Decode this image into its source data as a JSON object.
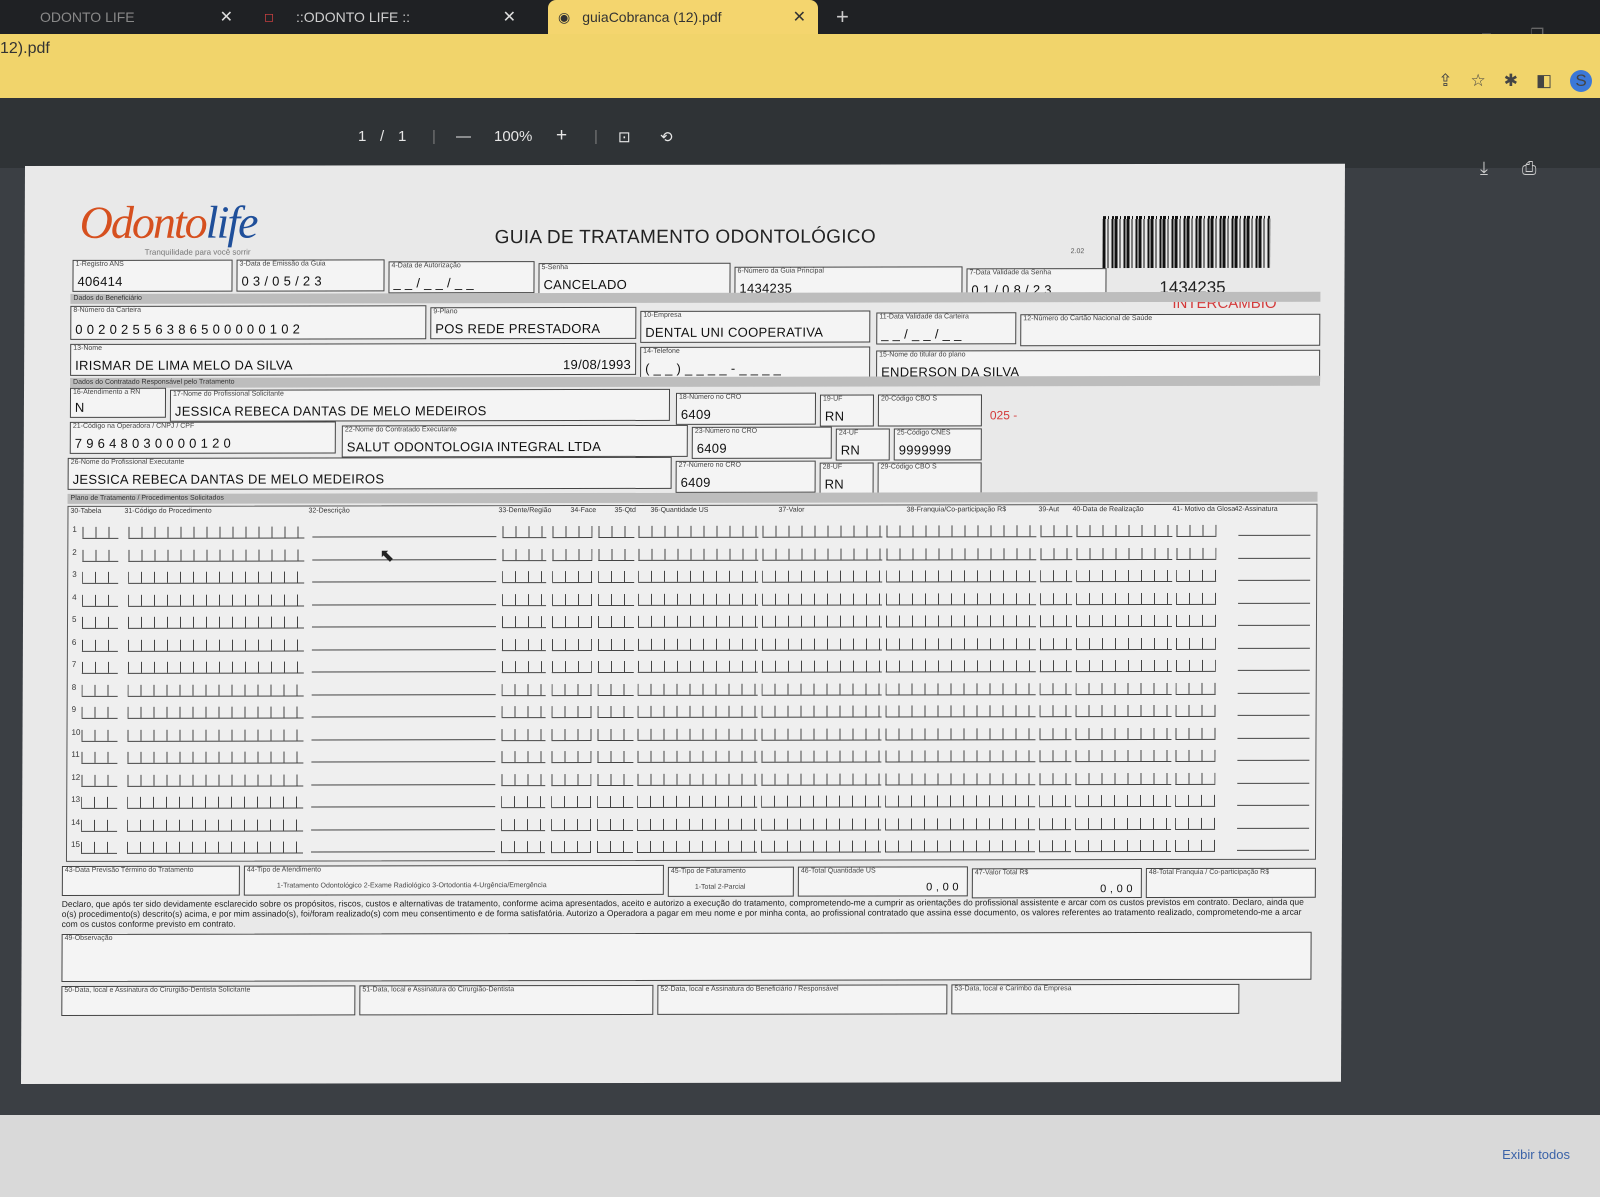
{
  "browser": {
    "tabs": [
      {
        "label": "ODONTO LIFE"
      },
      {
        "label": "::ODONTO LIFE ::"
      },
      {
        "label": "guiaCobranca (12).pdf"
      }
    ],
    "new_tab": "+",
    "url": "12).pdf",
    "close_glyph": "✕"
  },
  "viewer": {
    "page_current": "1",
    "page_sep": "/",
    "page_total": "1",
    "zoom_out": "—",
    "zoom": "100%",
    "zoom_in": "+"
  },
  "form": {
    "title": "GUIA DE TRATAMENTO ODONTOLÓGICO",
    "logo": {
      "odonto": "Odonto",
      "life": "life"
    },
    "logo_tagline": "Tranquilidade para você sorrir",
    "version": "2.02",
    "guide_number": "1434235",
    "intercambio": "INTERCÂMBIO",
    "fields": {
      "registro_ans": {
        "label": "1-Registro ANS",
        "value": "406414"
      },
      "data_emissao": {
        "label": "3-Data de Emissão da Guia",
        "value": "0 3 / 0 5 / 2 3"
      },
      "data_autorizacao": {
        "label": "4-Data de Autorização",
        "value": "_ _ / _ _ / _ _"
      },
      "senha": {
        "label": "5-Senha",
        "value": "CANCELADO"
      },
      "guia_principal": {
        "label": "6-Número da Guia Principal",
        "value": "1434235"
      },
      "validade_senha": {
        "label": "7-Data Validade da Senha",
        "value": "0 1 / 0 8 / 2 3"
      },
      "numero_carteira": {
        "label": "8-Número da Carteira",
        "value": "0 0 2 0 2 5 5 6 3 8 6 5 0 0 0 0 0 1 0 2"
      },
      "plano": {
        "label": "9-Plano",
        "value": "POS REDE PRESTADORA"
      },
      "empresa": {
        "label": "10-Empresa",
        "value": "DENTAL UNI COOPERATIVA"
      },
      "validade_carteira": {
        "label": "11-Data Validade da Carteira",
        "value": "_ _ / _ _ / _ _"
      },
      "cartao_saude": {
        "label": "12-Número do Cartão Nacional de Saúde",
        "value": ""
      },
      "nome": {
        "label": "13-Nome",
        "value": "IRISMAR DE LIMA MELO DA SILVA"
      },
      "nascimento": {
        "value": "19/08/1993"
      },
      "telefone": {
        "label": "14-Telefone",
        "value": "( _ _ ) _ _ _ _ - _ _ _ _"
      },
      "titular": {
        "label": "15-Nome do titular do plano",
        "value": "ENDERSON DA SILVA"
      },
      "atendimento_rn": {
        "label": "16-Atendimento a RN",
        "value": "N"
      },
      "prof_solicitante": {
        "label": "17-Nome do Profissional Solicitante",
        "value": "JESSICA REBECA DANTAS DE MELO MEDEIROS"
      },
      "cro_sol": {
        "label": "18-Número no CRO",
        "value": "6409"
      },
      "uf_sol": {
        "label": "19-UF",
        "value": "RN"
      },
      "cbo_sol": {
        "label": "20-Código CBO S",
        "value": ""
      },
      "cbo_red": "025 -",
      "codigo_operadora": {
        "label": "21-Código na Operadora / CNPJ / CPF",
        "value": "7 9 6 4 8 0 3 0 0 0 0 1 2 0"
      },
      "contratado": {
        "label": "22-Nome do Contratado Executante",
        "value": "SALUT ODONTOLOGIA INTEGRAL LTDA"
      },
      "cro_contr": {
        "label": "23-Número no CRO",
        "value": "6409"
      },
      "uf_contr": {
        "label": "24-UF",
        "value": "RN"
      },
      "cnes": {
        "label": "25-Código CNES",
        "value": "9999999"
      },
      "prof_executante": {
        "label": "26-Nome do Profissional Executante",
        "value": "JESSICA REBECA DANTAS DE MELO MEDEIROS"
      },
      "cro_exec": {
        "label": "27-Número no CRO",
        "value": "6409"
      },
      "uf_exec": {
        "label": "28-UF",
        "value": "RN"
      },
      "cbo_exec": {
        "label": "29-Código CBO S",
        "value": ""
      }
    },
    "sections": {
      "beneficiario": "Dados do Beneficiário",
      "contratado": "Dados do Contratado Responsável pelo Tratamento",
      "plano": "Plano de Tratamento / Procedimentos Solicitados"
    },
    "grid_headers": [
      "30-Tabela",
      "31-Código do Procedimento",
      "32-Descrição",
      "33-Dente/Região",
      "34-Face",
      "35-Qtd",
      "36-Quantidade US",
      "37-Valor",
      "38-Franquia/Co-participação R$",
      "39-Aut",
      "40-Data de Realização",
      "41- Motivo da Glosa",
      "42-Assinatura"
    ],
    "rows": [
      "1",
      "2",
      "3",
      "4",
      "5",
      "6",
      "7",
      "8",
      "9",
      "10",
      "11",
      "12",
      "13",
      "14",
      "15"
    ],
    "bottom": {
      "previsao": "43-Data Previsão Término do Tratamento",
      "tipo_atendimento": "44-Tipo de Atendimento",
      "tipo_opcoes": "1-Tratamento Odontológico  2-Exame Radiológico  3-Ortodontia  4-Urgência/Emergência",
      "tipo_faturamento": "45-Tipo de Faturamento",
      "fat_opcoes": "1-Total  2-Parcial",
      "total_us": "46-Total Quantidade US",
      "total_us_value": "0 , 0 0",
      "valor_total": "47-Valor Total R$",
      "valor_total_value": "0 , 0 0",
      "franquia": "48-Total Franquia / Co-participação R$"
    },
    "declaracao": "Declaro, que após ter sido devidamente esclarecido sobre os propósitos, riscos, custos e alternativas de tratamento, conforme acima apresentados, aceito e autorizo a execução do tratamento, comprometendo-me a cumprir as orientações do profissional assistente e arcar com os custos previstos em contrato. Declaro, ainda que o(s) procedimento(s) descrito(s) acima, e por mim assinado(s), foi/foram realizado(s) com meu consentimento e de forma satisfatória. Autorizo a Operadora a pagar em meu nome e por minha conta, ao profissional contratado que assina esse documento, os valores referentes ao tratamento realizado, comprometendo-me a arcar com os custos conforme previsto em contrato.",
    "observacao": "49-Observação",
    "assinaturas": [
      "50-Data, local e Assinatura do Cirurgião-Dentista Solicitante",
      "51-Data, local e Assinatura do Cirurgião-Dentista",
      "52-Data, local e Assinatura do Beneficiário / Responsável",
      "53-Data, local e Carimbo da Empresa"
    ]
  },
  "download_bar": {
    "show_all": "Exibir todos"
  }
}
